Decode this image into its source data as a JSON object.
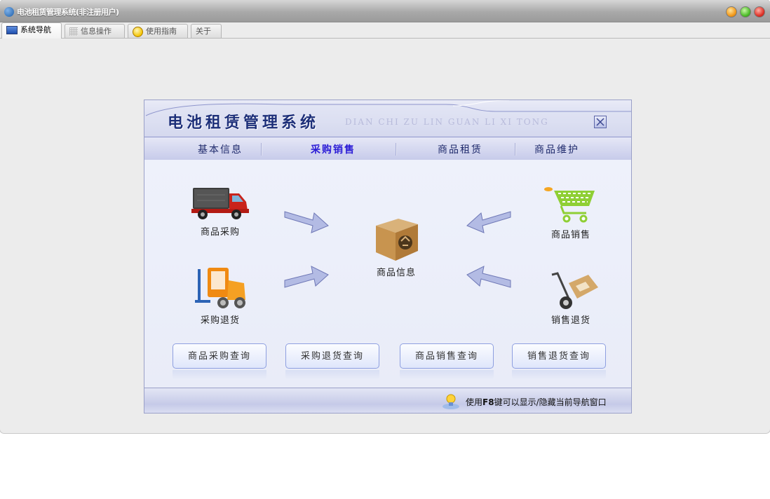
{
  "window": {
    "title": "电池租赁管理系统(非注册用户)",
    "controls": [
      "minimize",
      "maximize",
      "close"
    ]
  },
  "tabs": [
    {
      "label": "系统导航",
      "icon": "monitor-icon",
      "active": true
    },
    {
      "label": "信息操作",
      "icon": "grid-icon",
      "active": false
    },
    {
      "label": "使用指南",
      "icon": "help-icon",
      "active": false
    },
    {
      "label": "关于",
      "icon": "",
      "active": false
    }
  ],
  "panel": {
    "title": "电池租赁管理系统",
    "subtitle": "DIAN CHI ZU LIN GUAN LI XI TONG",
    "nav": [
      {
        "label": "基本信息",
        "active": false
      },
      {
        "label": "采购销售",
        "active": true
      },
      {
        "label": "商品租赁",
        "active": false
      },
      {
        "label": "商品维护",
        "active": false
      }
    ],
    "items": {
      "purchase": "商品采购",
      "purchase_return": "采购退货",
      "goods_info": "商品信息",
      "sales": "商品销售",
      "sales_return": "销售退货"
    },
    "query_buttons": [
      "商品采购查询",
      "采购退货查询",
      "商品销售查询",
      "销售退货查询"
    ],
    "footer": {
      "prefix": "使用",
      "key": "F8",
      "suffix": "键可以显示/隐藏当前导航窗口"
    }
  },
  "colors": {
    "accent": "#1d2f79",
    "active_nav": "#2a1bd6",
    "panel_border": "#9aa0c8"
  }
}
